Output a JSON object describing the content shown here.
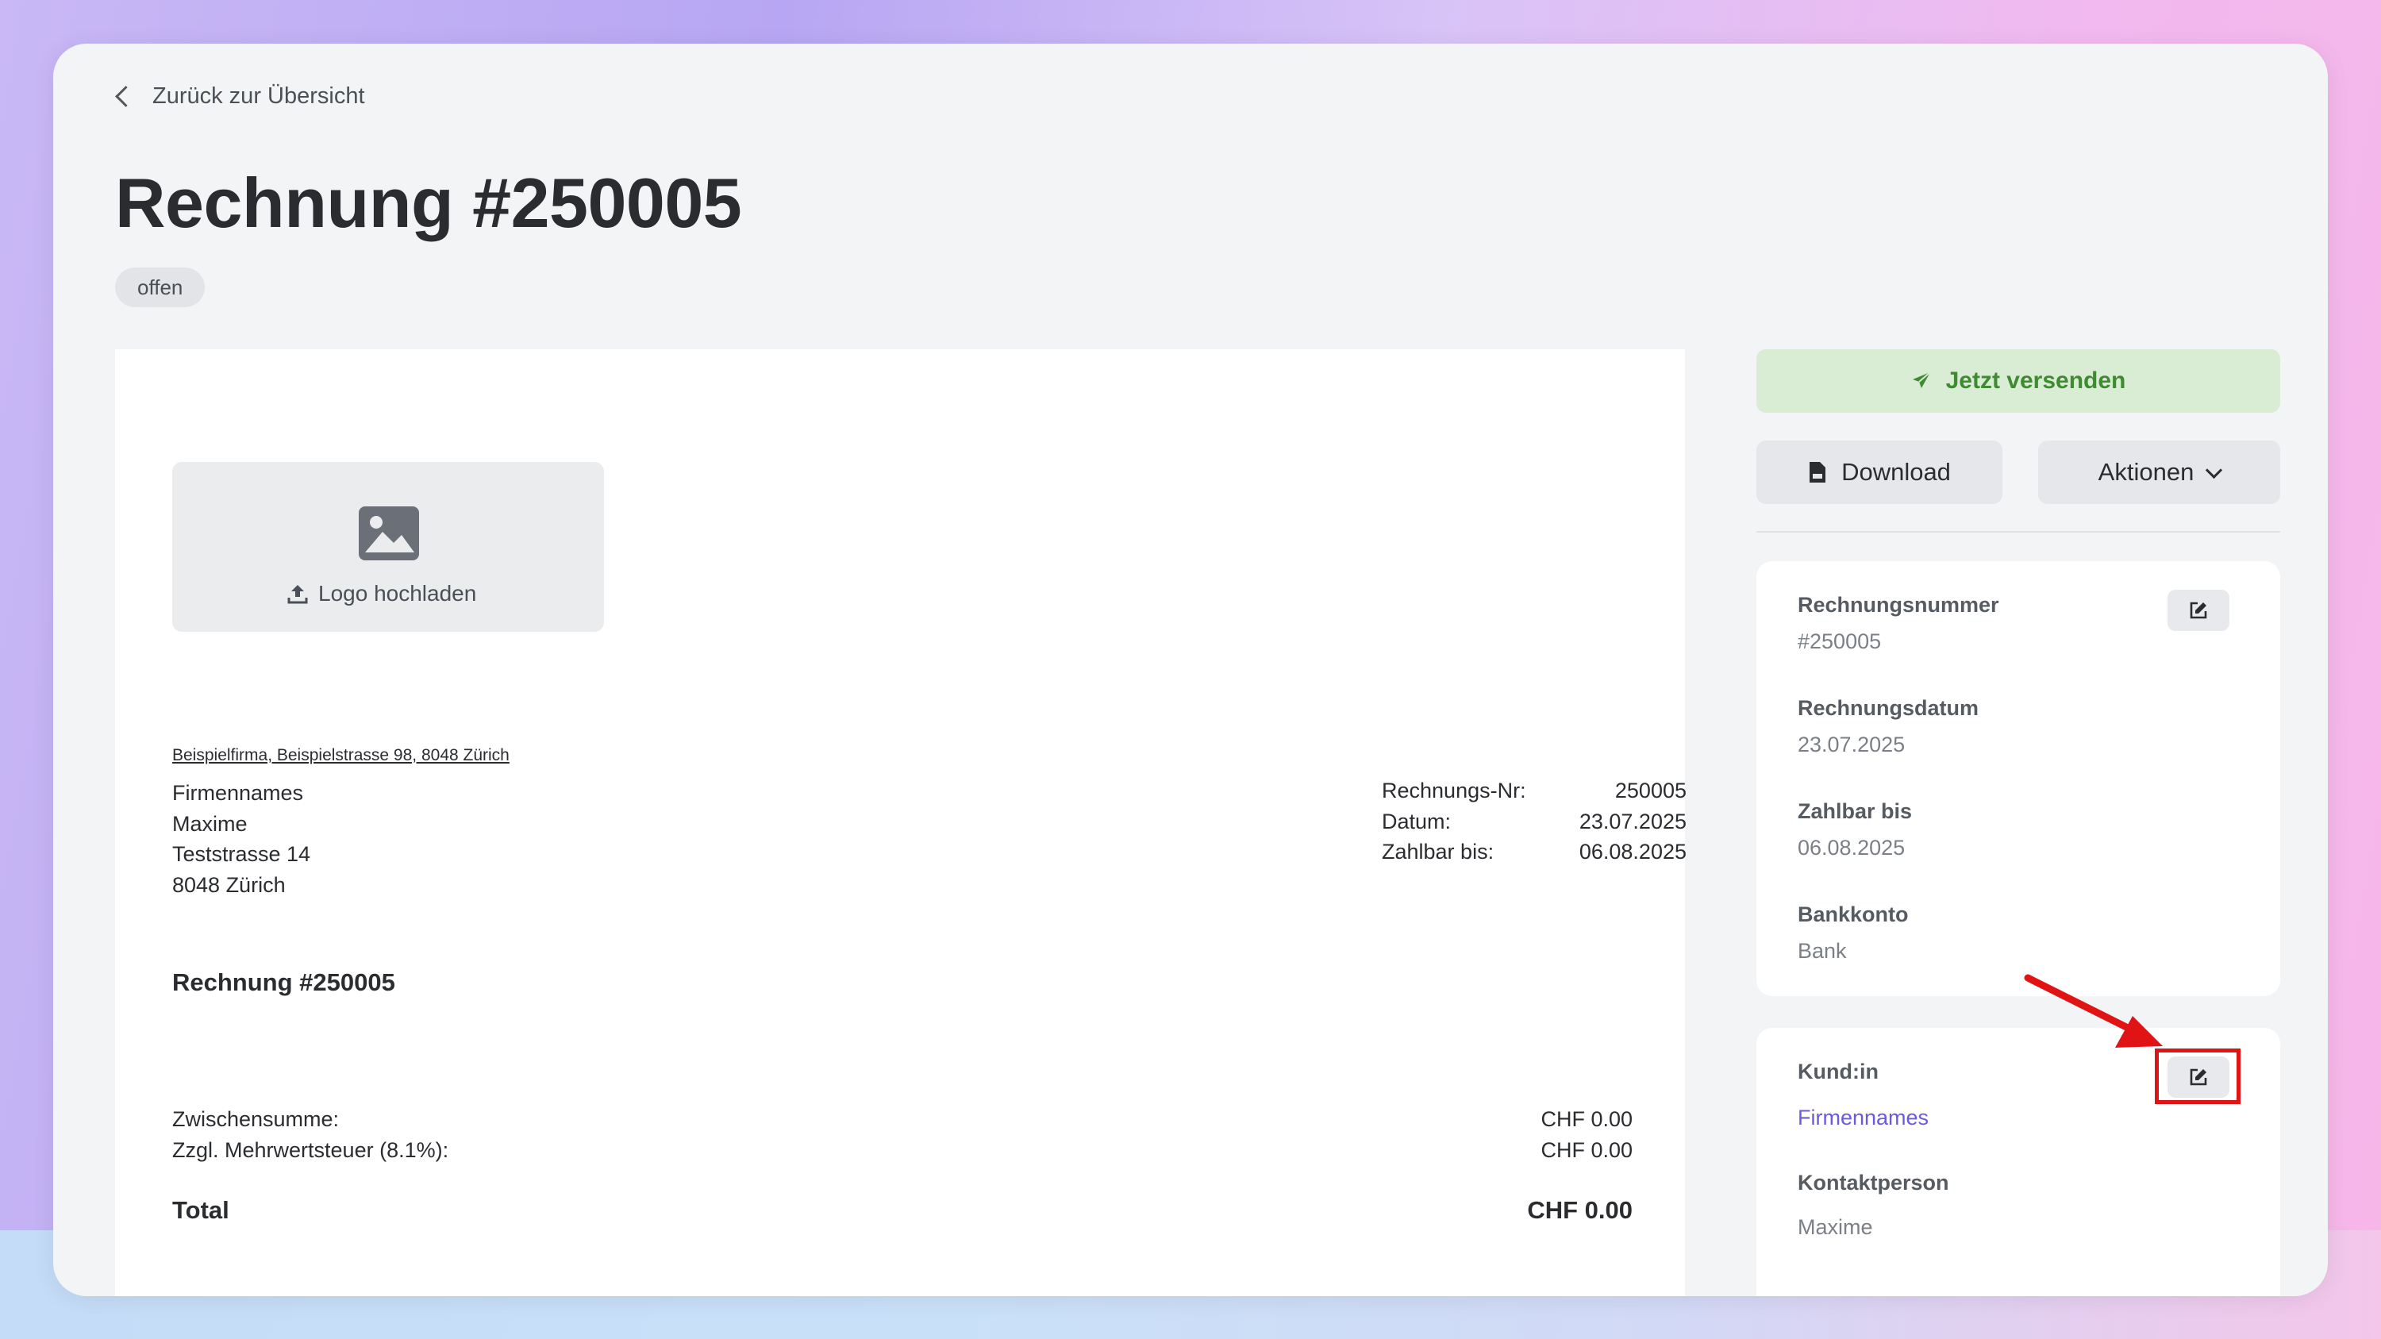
{
  "back": {
    "label": "Zurück zur Übersicht"
  },
  "page": {
    "title": "Rechnung #250005",
    "status": "offen"
  },
  "invoice": {
    "logo_upload_label": "Logo hochladen",
    "sender_line": "Beispielfirma, Beispielstrasse 98, 8048 Zürich",
    "recipient": [
      "Firmennames",
      "Maxime",
      "Teststrasse 14",
      "8048 Zürich"
    ],
    "meta": [
      {
        "label": "Rechnungs-Nr:",
        "value": "250005"
      },
      {
        "label": "Datum:",
        "value": "23.07.2025"
      },
      {
        "label": "Zahlbar bis:",
        "value": "06.08.2025"
      }
    ],
    "doc_title": "Rechnung #250005",
    "subtotal": {
      "label": "Zwischensumme:",
      "value": "CHF 0.00"
    },
    "vat": {
      "label": "Zzgl. Mehrwertsteuer (8.1%):",
      "value": "CHF 0.00"
    },
    "total": {
      "label": "Total",
      "value": "CHF 0.00"
    }
  },
  "actions": {
    "send_label": "Jetzt versenden",
    "download_label": "Download",
    "more_label": "Aktionen"
  },
  "details": {
    "invoice_number": {
      "label": "Rechnungsnummer",
      "value": "#250005"
    },
    "invoice_date": {
      "label": "Rechnungsdatum",
      "value": "23.07.2025"
    },
    "due_date": {
      "label": "Zahlbar bis",
      "value": "06.08.2025"
    },
    "bank_account": {
      "label": "Bankkonto",
      "value": "Bank"
    }
  },
  "customer": {
    "label": "Kund:in",
    "name": "Firmennames",
    "contact_label": "Kontaktperson",
    "contact_value": "Maxime"
  },
  "colors": {
    "accent_green": "#3f8a32",
    "send_bg": "#d9ecd4",
    "link_purple": "#6a5ae0",
    "highlight_red": "#e01414"
  },
  "icons": {
    "back": "chevron-left-icon",
    "logo": "image-icon",
    "upload": "upload-icon",
    "send": "paper-plane-icon",
    "download": "pdf-file-icon",
    "more": "chevron-down-icon",
    "edit": "edit-icon",
    "annotation": "red-arrow"
  }
}
